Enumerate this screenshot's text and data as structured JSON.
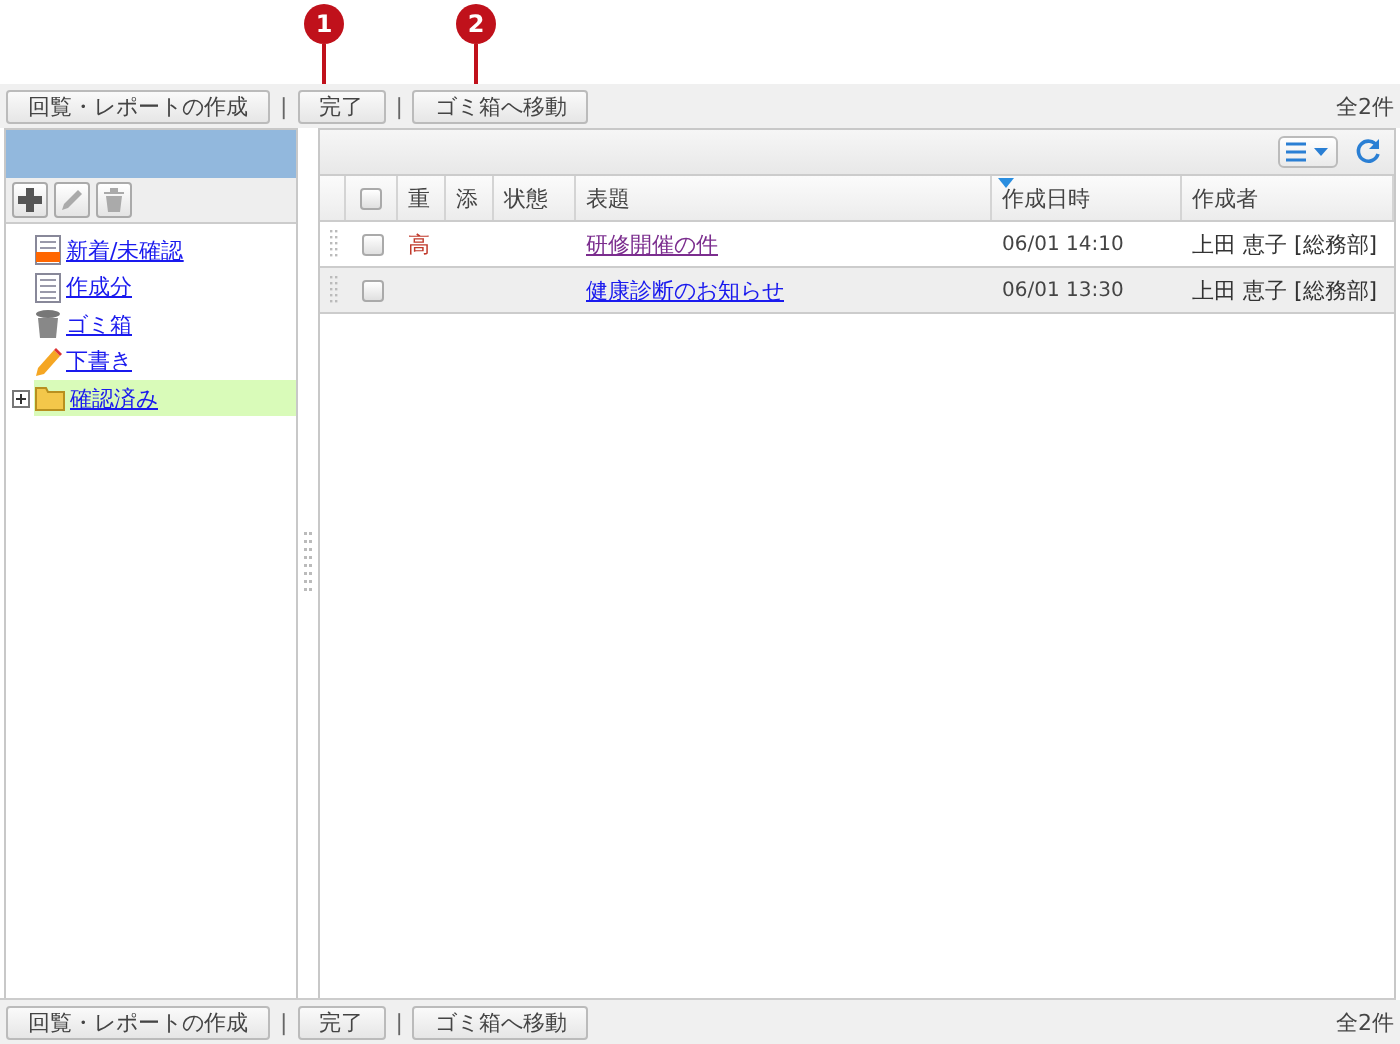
{
  "callouts": [
    {
      "label": "1"
    },
    {
      "label": "2"
    }
  ],
  "toolbar_top": {
    "buttons": [
      "回覧・レポートの作成",
      "完了",
      "ゴミ箱へ移動"
    ],
    "separator": "|",
    "count": "全2件"
  },
  "sidebar": {
    "items": [
      {
        "label": "新着/未確認",
        "kind": "new",
        "selected": false
      },
      {
        "label": "作成分",
        "kind": "doc",
        "selected": false
      },
      {
        "label": "ゴミ箱",
        "kind": "trash",
        "selected": false
      },
      {
        "label": "下書き",
        "kind": "pencil",
        "selected": false
      },
      {
        "label": "確認済み",
        "kind": "folder",
        "selected": true,
        "expanded": false
      }
    ]
  },
  "table": {
    "select_all_checked": false,
    "columns": [
      {
        "label": "重",
        "sorted": false
      },
      {
        "label": "添",
        "sorted": false
      },
      {
        "label": "状態",
        "sorted": false
      },
      {
        "label": "表題",
        "sorted": false
      },
      {
        "label": "作成日時",
        "sorted": true
      },
      {
        "label": "作成者",
        "sorted": false
      }
    ],
    "rows": [
      {
        "checked": false,
        "priority": "高",
        "title": "研修開催の件",
        "visited": true,
        "created": "06/01 14:10",
        "author": "上田 恵子 [総務部]",
        "selected": false
      },
      {
        "checked": false,
        "priority": "",
        "title": "健康診断のお知らせ",
        "visited": false,
        "created": "06/01 13:30",
        "author": "上田 恵子 [総務部]",
        "selected": true
      }
    ]
  },
  "toolbar_bottom": {
    "buttons": [
      "回覧・レポートの作成",
      "完了",
      "ゴミ箱へ移動"
    ],
    "separator": "|",
    "count": "全2件"
  }
}
